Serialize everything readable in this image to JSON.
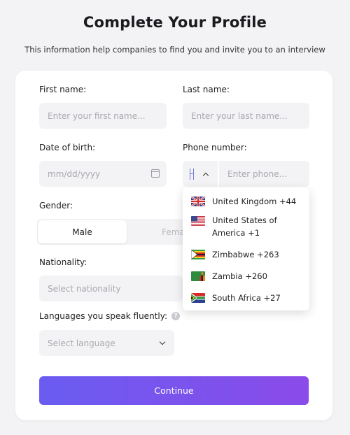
{
  "header": {
    "title": "Complete Your Profile",
    "subtitle": "This information help companies to find you and invite you to an interview"
  },
  "form": {
    "first_name": {
      "label": "First name:",
      "placeholder": "Enter your first name..."
    },
    "last_name": {
      "label": "Last name:",
      "placeholder": "Enter your last name..."
    },
    "dob": {
      "label": "Date of birth:",
      "placeholder": "mm/dd/yyyy",
      "icon": "calendar-icon"
    },
    "phone": {
      "label": "Phone number:",
      "placeholder": "Enter phone..."
    },
    "gender": {
      "label": "Gender:",
      "options": [
        "Male",
        "Fema"
      ],
      "selected": "Male"
    },
    "nationality": {
      "label": "Nationality:",
      "placeholder": "Select nationality"
    },
    "languages": {
      "label": "Languages you speak fluently:",
      "placeholder": "Select language",
      "help_icon": "?"
    },
    "submit_label": "Continue"
  },
  "phone_dropdown": {
    "items": [
      {
        "flag": "uk-flag-icon",
        "name": "United Kingdom +44"
      },
      {
        "flag": "us-flag-icon",
        "name": "United States of America +1"
      },
      {
        "flag": "zimbabwe-flag-icon",
        "name": "Zimbabwe +263"
      },
      {
        "flag": "zambia-flag-icon",
        "name": "Zambia +260"
      },
      {
        "flag": "south-africa-flag-icon",
        "name": "South Africa +27"
      }
    ]
  },
  "colors": {
    "accent_start": "#6a5cf0",
    "accent_end": "#8a4bea",
    "field_bg": "#f3f3f5"
  }
}
